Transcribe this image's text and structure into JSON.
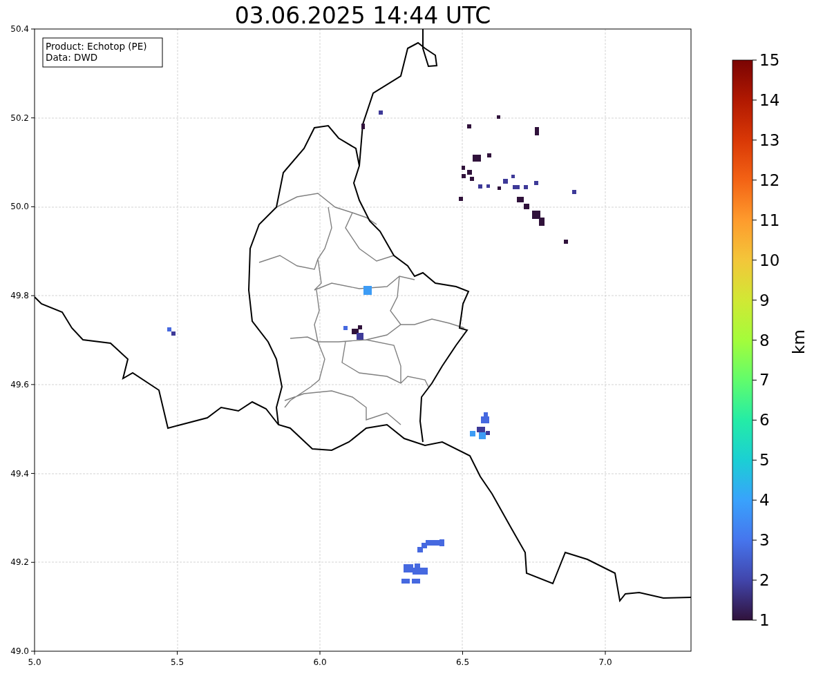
{
  "figure": {
    "title": "03.06.2025 14:44 UTC"
  },
  "legend": {
    "lines": [
      "Product: Echotop (PE)",
      "Data: DWD"
    ]
  },
  "map": {
    "xticks": [
      "5.0",
      "5.5",
      "6.0",
      "6.5",
      "7.0"
    ],
    "yticks": [
      "50.4",
      "50.2",
      "50.0",
      "49.8",
      "49.6",
      "49.4",
      "49.2",
      "49.0"
    ]
  },
  "colorbar": {
    "label": "km",
    "ticks": [
      "15",
      "14",
      "13",
      "12",
      "11",
      "10",
      "9",
      "8",
      "7",
      "6",
      "5",
      "4",
      "3",
      "2",
      "1"
    ]
  }
}
